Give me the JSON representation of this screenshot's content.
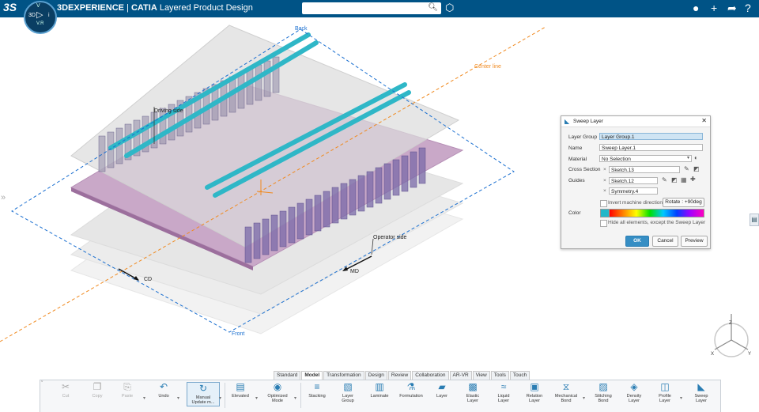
{
  "app": {
    "brand_prefix": "3DEXPERIENCE",
    "brand_sep": " | ",
    "brand_product": "CATIA",
    "brand_app": " Layered Product Design",
    "compass": {
      "top": "V",
      "left": "3D",
      "right": "i",
      "bottom": "V.R"
    }
  },
  "search": {
    "value": "",
    "placeholder": ""
  },
  "icons": {
    "logo": "ds-logo-icon",
    "search": "search-icon",
    "tag": "tag-icon",
    "user": "user-avatar-icon",
    "add": "plus-icon",
    "share": "share-icon",
    "help": "help-icon"
  },
  "scene": {
    "labels": {
      "back": "Back",
      "front": "Front",
      "center_line": "Center line",
      "driving_side": "Driving side",
      "operator_side": "Operator side",
      "cd": "CD",
      "md": "MD"
    },
    "axis": {
      "z": "Z",
      "x": "X",
      "y": "Y"
    },
    "colors": {
      "fiber": "#2fb7c7",
      "sheet": "#c9a8c8",
      "dashed_blue": "#1a6fd0",
      "dashed_orange": "#f08a20"
    }
  },
  "dialog": {
    "title": "Sweep Layer",
    "layer_group_label": "Layer Group",
    "layer_group_value": "Layer Group.1",
    "name_label": "Name",
    "name_value": "Sweep Layer.1",
    "material_label": "Material",
    "material_value": "No Selection",
    "cross_section_label": "Cross Section",
    "cross_section_value": "Sketch.13",
    "guides_label": "Guides",
    "guide_1": "Sketch.12",
    "guide_2": "Symmetry.4",
    "invert_label": "Invert machine direction",
    "rotate_label": "Rotate : +90deg",
    "color_label": "Color",
    "color_value": "#21b7c9",
    "hide_label": "Hide all elements, except the Sweep Layer",
    "ok": "OK",
    "cancel": "Cancel",
    "preview": "Preview"
  },
  "tabs": [
    "Standard",
    "Model",
    "Transformation",
    "Design",
    "Review",
    "Collaboration",
    "AR-VR",
    "View",
    "Tools",
    "Touch"
  ],
  "active_tab": "Model",
  "toolbar": {
    "cut": "Cut",
    "copy": "Copy",
    "paste": "Paste",
    "undo": "Undo",
    "manual_update": "Manual Update m...",
    "elevated": "Elevated",
    "optimized_mode": "Optimized Mode",
    "stacking": "Stacking",
    "layer_group": "Layer Group",
    "laminate": "Laminate",
    "formulation": "Formulation",
    "layer": "Layer",
    "elastic_layer": "Elastic Layer",
    "liquid_layer": "Liquid Layer",
    "relation_layer": "Relation Layer",
    "mechanical_bond": "Mechanical Bond",
    "stitching_bond": "Stitching Bond",
    "density_layer": "Density Layer",
    "profile_layer": "Profile Layer",
    "sweep_layer": "Sweep Layer"
  }
}
